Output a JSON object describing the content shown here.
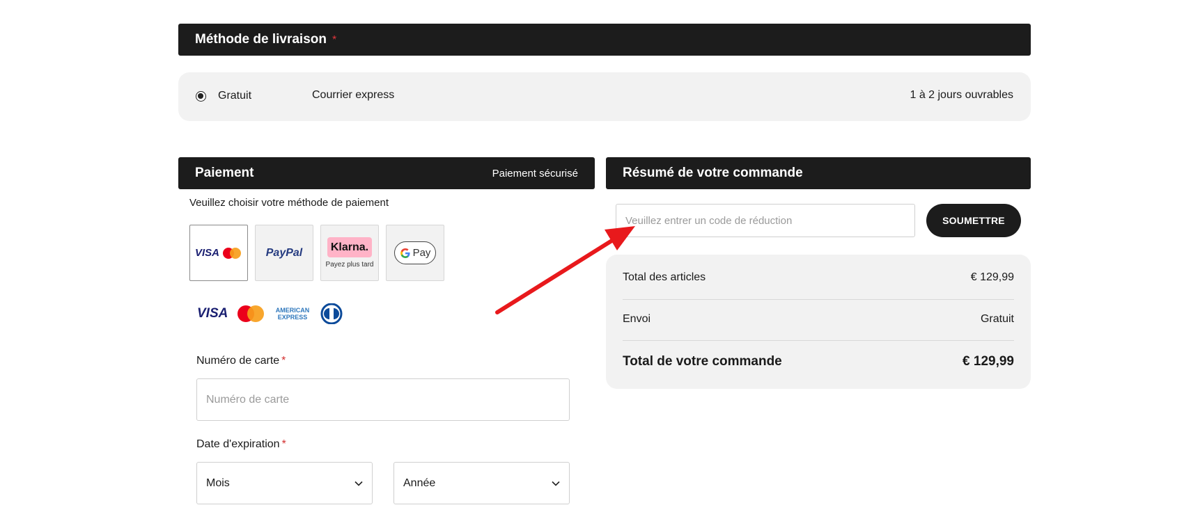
{
  "shipping": {
    "header_title": "Méthode de livraison",
    "required_mark": "*",
    "option_price": "Gratuit",
    "option_carrier": "Courrier express",
    "option_delay": "1 à 2 jours ouvrables"
  },
  "payment": {
    "header_title": "Paiement",
    "header_secure": "Paiement sécurisé",
    "instruction": "Veuillez choisir votre méthode de paiement",
    "methods": [
      {
        "id": "card",
        "label": "VISA",
        "selected": true
      },
      {
        "id": "paypal",
        "label": "PayPal",
        "selected": false
      },
      {
        "id": "klarna",
        "label": "Klarna.",
        "sublabel": "Payez plus tard",
        "selected": false
      },
      {
        "id": "gpay",
        "label": "Pay",
        "selected": false
      }
    ],
    "card_brands": {
      "visa": "VISA",
      "amex_line1": "AMERICAN",
      "amex_line2": "EXPRESS"
    },
    "card_number_label": "Numéro de carte",
    "card_number_placeholder": "Numéro de carte",
    "expiry_label": "Date d'expiration",
    "required_mark": "*",
    "month_value": "Mois",
    "year_value": "Année"
  },
  "summary": {
    "header_title": "Résumé de votre commande",
    "discount_placeholder": "Veuillez entrer un code de réduction",
    "submit_label": "SOUMETTRE",
    "rows": [
      {
        "label": "Total des articles",
        "value": "€ 129,99"
      },
      {
        "label": "Envoi",
        "value": "Gratuit"
      }
    ],
    "total_label": "Total de votre commande",
    "total_value": "€ 129,99"
  },
  "colors": {
    "header_bg": "#1c1c1c",
    "panel_bg": "#f2f2f2",
    "required_red": "#e0363c",
    "arrow_red": "#e8191c",
    "klarna_pink": "#ffb3c7",
    "visa_blue": "#1a1f71",
    "paypal_blue": "#253b80",
    "amex_blue": "#2e77bc",
    "diners_blue": "#0b4a9a",
    "mastercard_red": "#eb001b",
    "mastercard_orange": "#f79e1b"
  }
}
